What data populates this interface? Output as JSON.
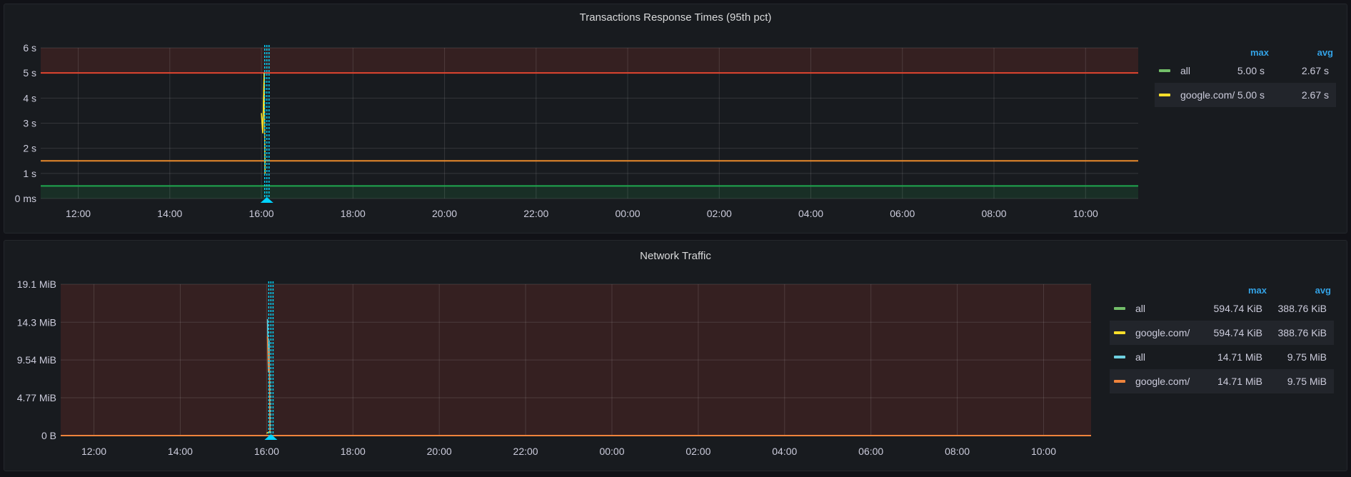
{
  "panels": [
    {
      "title": "Transactions Response Times (95th pct)",
      "legend": {
        "headers": [
          "max",
          "avg"
        ],
        "items": [
          {
            "name": "all",
            "color": "#73bf69",
            "max": "5.00 s",
            "avg": "2.67 s"
          },
          {
            "name": "google.com/",
            "color": "#fade2a",
            "max": "5.00 s",
            "avg": "2.67 s"
          }
        ]
      },
      "chart_data": {
        "type": "line",
        "ylim": [
          0,
          6
        ],
        "yticks": [
          "0 ms",
          "1 s",
          "2 s",
          "3 s",
          "4 s",
          "5 s",
          "6 s"
        ],
        "ytick_values": [
          0,
          1,
          2,
          3,
          4,
          5,
          6
        ],
        "x_range_hours": [
          11.18,
          35.15
        ],
        "xticks": [
          "12:00",
          "14:00",
          "16:00",
          "18:00",
          "20:00",
          "22:00",
          "00:00",
          "02:00",
          "04:00",
          "06:00",
          "08:00",
          "10:00"
        ],
        "thresholds": [
          {
            "value": 5,
            "color": "#e0452f",
            "fill": "above"
          },
          {
            "value": 1.5,
            "color": "#e8892c"
          },
          {
            "value": 0.5,
            "color": "#1fa84f",
            "fill": "below"
          }
        ],
        "annotation_hour": 16.12,
        "series": [
          {
            "name": "all",
            "color": "#73bf69",
            "points": [
              [
                16.0,
                3.4
              ],
              [
                16.03,
                2.6
              ],
              [
                16.06,
                5.0
              ],
              [
                16.08,
                1.0
              ]
            ]
          },
          {
            "name": "google.com/",
            "color": "#fade2a",
            "points": [
              [
                16.0,
                3.4
              ],
              [
                16.03,
                2.6
              ],
              [
                16.06,
                5.0
              ],
              [
                16.08,
                1.0
              ]
            ]
          }
        ]
      }
    },
    {
      "title": "Network Traffic",
      "legend": {
        "headers": [
          "max",
          "avg"
        ],
        "items": [
          {
            "name": "all",
            "color": "#73bf69",
            "max": "594.74 KiB",
            "avg": "388.76 KiB"
          },
          {
            "name": "google.com/",
            "color": "#fade2a",
            "max": "594.74 KiB",
            "avg": "388.76 KiB"
          },
          {
            "name": "all",
            "color": "#6ed0e0",
            "max": "14.71 MiB",
            "avg": "9.75 MiB"
          },
          {
            "name": "google.com/",
            "color": "#ef843c",
            "max": "14.71 MiB",
            "avg": "9.75 MiB"
          }
        ]
      },
      "chart_data": {
        "type": "line",
        "ylim": [
          0,
          19.1
        ],
        "yticks": [
          "0 B",
          "4.77 MiB",
          "9.54 MiB",
          "14.3 MiB",
          "19.1 MiB"
        ],
        "ytick_values": [
          0,
          4.77,
          9.54,
          14.3,
          19.1
        ],
        "x_range_hours": [
          11.23,
          35.1
        ],
        "xticks": [
          "12:00",
          "14:00",
          "16:00",
          "18:00",
          "20:00",
          "22:00",
          "00:00",
          "02:00",
          "04:00",
          "06:00",
          "08:00",
          "10:00"
        ],
        "thresholds": [
          {
            "value": 0,
            "color": "#e0452f",
            "fill": "above"
          }
        ],
        "annotation_hour": 16.1,
        "series": [
          {
            "name": "all",
            "color": "#6ed0e0",
            "points": [
              [
                16.02,
                14.7
              ],
              [
                16.04,
                8.5
              ],
              [
                16.06,
                12.0
              ],
              [
                16.08,
                0.3
              ]
            ]
          },
          {
            "name": "google.com/",
            "color": "#ef843c",
            "points": [
              [
                16.02,
                12.5
              ],
              [
                16.04,
                8.0
              ],
              [
                16.06,
                11.0
              ],
              [
                16.08,
                0.3
              ]
            ]
          },
          {
            "name": "all",
            "color": "#73bf69",
            "points": [
              [
                16.0,
                0.3
              ],
              [
                16.08,
                0.5
              ]
            ]
          },
          {
            "name": "google.com/",
            "color": "#fade2a",
            "points": [
              [
                16.0,
                0.3
              ],
              [
                16.08,
                0.5
              ]
            ]
          }
        ]
      }
    }
  ]
}
